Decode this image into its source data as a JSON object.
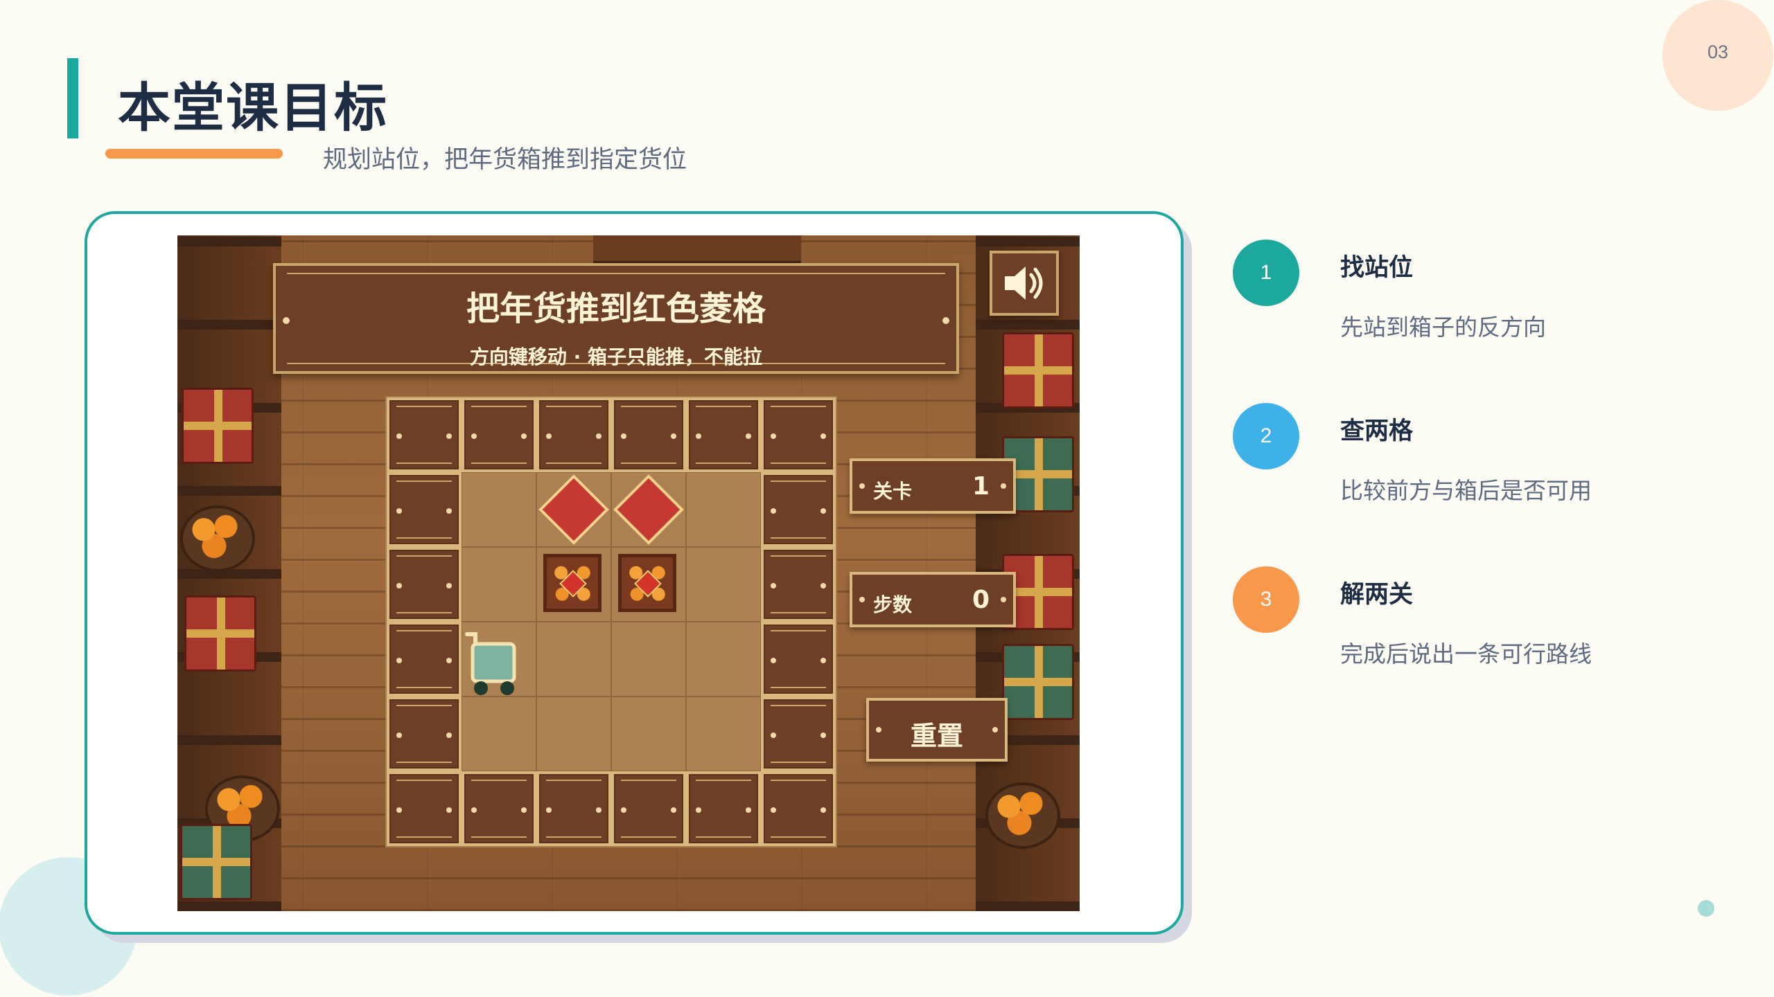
{
  "page_number": "03",
  "header": {
    "title": "本堂课目标",
    "subtitle": "规划站位，把年货箱推到指定货位"
  },
  "game": {
    "banner_title": "把年货推到红色菱格",
    "banner_subtitle": "方向键移动 · 箱子只能推，不能拉",
    "level_label": "关卡",
    "level_value": "1",
    "steps_label": "步数",
    "steps_value": "0",
    "reset_label": "重置",
    "sound_icon": "speaker-icon"
  },
  "steps": [
    {
      "number": "1",
      "title": "找站位",
      "description": "先站到箱子的反方向",
      "color": "#1da89e"
    },
    {
      "number": "2",
      "title": "查两格",
      "description": "比较前方与箱后是否可用",
      "color": "#3eb2e8"
    },
    {
      "number": "3",
      "title": "解两关",
      "description": "完成后说出一条可行路线",
      "color": "#f7984b"
    }
  ],
  "colors": {
    "accent_teal": "#1da89e",
    "accent_orange": "#f7984b",
    "background": "#fcfbf4"
  }
}
